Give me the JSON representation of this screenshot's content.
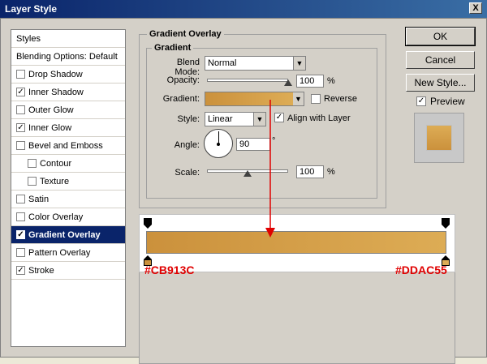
{
  "window": {
    "title": "Layer Style",
    "close_glyph": "X"
  },
  "styles_list": [
    {
      "label": "Styles",
      "type": "header",
      "checked": false
    },
    {
      "label": "Blending Options: Default",
      "type": "header",
      "checked": false
    },
    {
      "label": "Drop Shadow",
      "type": "item",
      "checked": false
    },
    {
      "label": "Inner Shadow",
      "type": "item",
      "checked": true
    },
    {
      "label": "Outer Glow",
      "type": "item",
      "checked": false
    },
    {
      "label": "Inner Glow",
      "type": "item",
      "checked": true
    },
    {
      "label": "Bevel and Emboss",
      "type": "item",
      "checked": false
    },
    {
      "label": "Contour",
      "type": "subitem",
      "checked": false
    },
    {
      "label": "Texture",
      "type": "subitem",
      "checked": false
    },
    {
      "label": "Satin",
      "type": "item",
      "checked": false
    },
    {
      "label": "Color Overlay",
      "type": "item",
      "checked": false
    },
    {
      "label": "Gradient Overlay",
      "type": "item",
      "checked": true,
      "selected": true
    },
    {
      "label": "Pattern Overlay",
      "type": "item",
      "checked": false
    },
    {
      "label": "Stroke",
      "type": "item",
      "checked": true
    }
  ],
  "panel": {
    "title": "Gradient Overlay",
    "subtitle": "Gradient",
    "blend_mode_label": "Blend Mode:",
    "blend_mode_value": "Normal",
    "opacity_label": "Opacity:",
    "opacity_value": "100",
    "opacity_unit": "%",
    "opacity_fraction": 1.0,
    "gradient_label": "Gradient:",
    "reverse_label": "Reverse",
    "reverse_checked": false,
    "style_label": "Style:",
    "style_value": "Linear",
    "align_label": "Align with Layer",
    "align_checked": true,
    "angle_label": "Angle:",
    "angle_value": "90",
    "angle_unit": "°",
    "scale_label": "Scale:",
    "scale_value": "100",
    "scale_unit": "%",
    "scale_fraction": 0.5
  },
  "buttons": {
    "ok": "OK",
    "cancel": "Cancel",
    "new_style": "New Style...",
    "preview_label": "Preview",
    "preview_checked": true
  },
  "gradient": {
    "start_color": "#CB913C",
    "end_color": "#DDAC55",
    "start_label": "#CB913C",
    "end_label": "#DDAC55"
  },
  "icons": {
    "check": "✓",
    "dropdown": "▼"
  }
}
